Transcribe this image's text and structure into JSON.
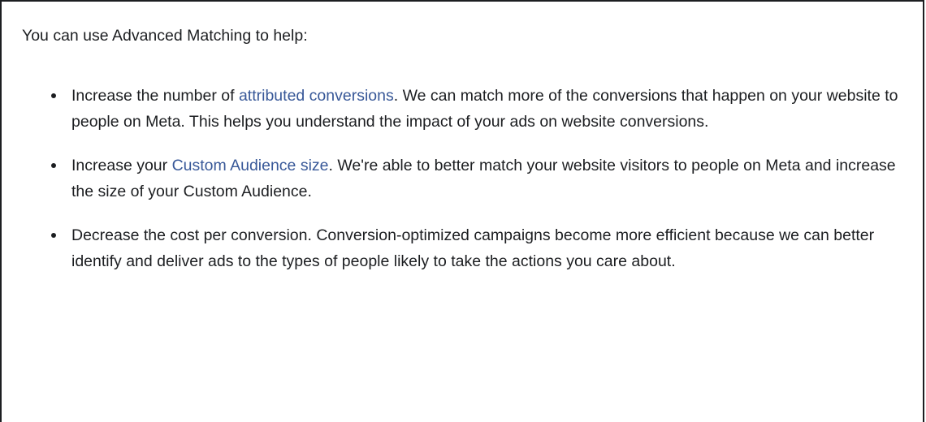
{
  "intro": "You can use Advanced Matching to help:",
  "colors": {
    "text": "#1c1e21",
    "link": "#385898",
    "border": "#1c1e21"
  },
  "bullets": [
    {
      "before": "Increase the number of ",
      "link": "attributed conversions",
      "after": ". We can match more of the conversions that happen on your website to people on Meta. This helps you understand the impact of your ads on website conversions."
    },
    {
      "before": "Increase your ",
      "link": "Custom Audience size",
      "after": ". We're able to better match your website visitors to people on Meta and increase the size of your Custom Audience."
    },
    {
      "text": "Decrease the cost per conversion. Conversion-optimized campaigns become more efficient because we can better identify and deliver ads to the types of people likely to take the actions you care about."
    }
  ]
}
